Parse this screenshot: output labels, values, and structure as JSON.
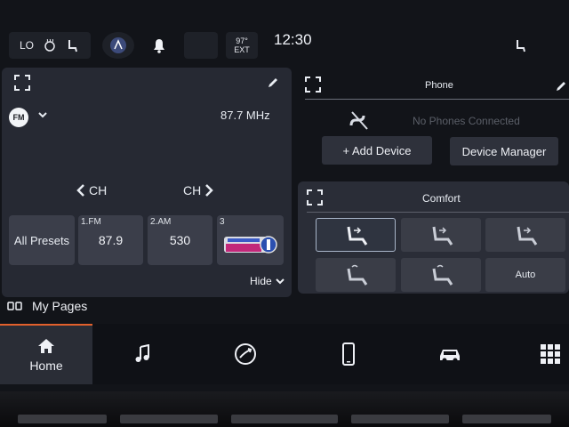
{
  "status_bar": {
    "climate_left_temp": "LO",
    "outside_temp_value": "97°",
    "outside_temp_label": "EXT",
    "clock": "12:30"
  },
  "radio": {
    "band": "FM",
    "frequency": "87.7 MHz",
    "ch_prev_label": "CH",
    "ch_next_label": "CH",
    "all_presets_label": "All Presets",
    "presets": [
      {
        "num": "1.FM",
        "value": "87.9"
      },
      {
        "num": "2.AM",
        "value": "530"
      },
      {
        "num": "3",
        "value": ""
      }
    ],
    "hide_label": "Hide"
  },
  "phone": {
    "title": "Phone",
    "status": "No Phones Connected",
    "add_device_label": "+ Add Device",
    "device_manager_label": "Device Manager"
  },
  "comfort": {
    "title": "Comfort",
    "auto_label": "Auto"
  },
  "my_pages_label": "My Pages",
  "nav": {
    "home_label": "Home"
  },
  "colors": {
    "accent_home": "#e2602c",
    "panel_bg": "#262933",
    "text": "#e8ecf2"
  },
  "icons": [
    "climate-icon",
    "seat-heat-icon",
    "driver-profile-icon",
    "bell-icon",
    "expand-icon",
    "edit-icon",
    "phone-off-icon",
    "seat-icon",
    "music-icon",
    "apps-icon",
    "phone-icon",
    "car-icon",
    "grid-icon"
  ]
}
